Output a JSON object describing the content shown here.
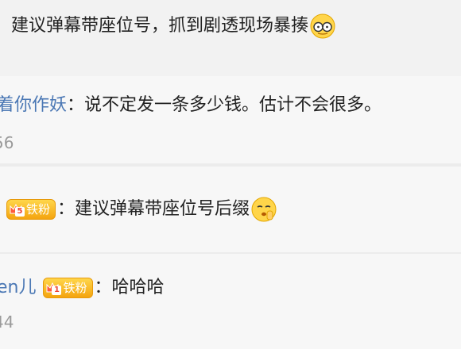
{
  "comments": [
    {
      "text": "建议弹幕带座位号，抓到剧透现场暴揍",
      "emoji": "nerd-glasses-emoji"
    },
    {
      "user": "着你作妖",
      "colon": "：",
      "text": "说不定发一条多少钱。估计不会很多。",
      "meta": "56"
    },
    {
      "badge": {
        "level": "5",
        "label": "铁粉"
      },
      "colon": "：",
      "text": "建议弹幕带座位号后缀",
      "emoji": "shush-emoji"
    },
    {
      "user": "en儿",
      "badge": {
        "level": "1",
        "label": "铁粉"
      },
      "colon": "：",
      "text": "哈哈哈",
      "meta": "44"
    }
  ],
  "colors": {
    "username": "#4a77b4",
    "text": "#222222",
    "meta": "#9a9a9a",
    "badge": "#f4a40f"
  }
}
